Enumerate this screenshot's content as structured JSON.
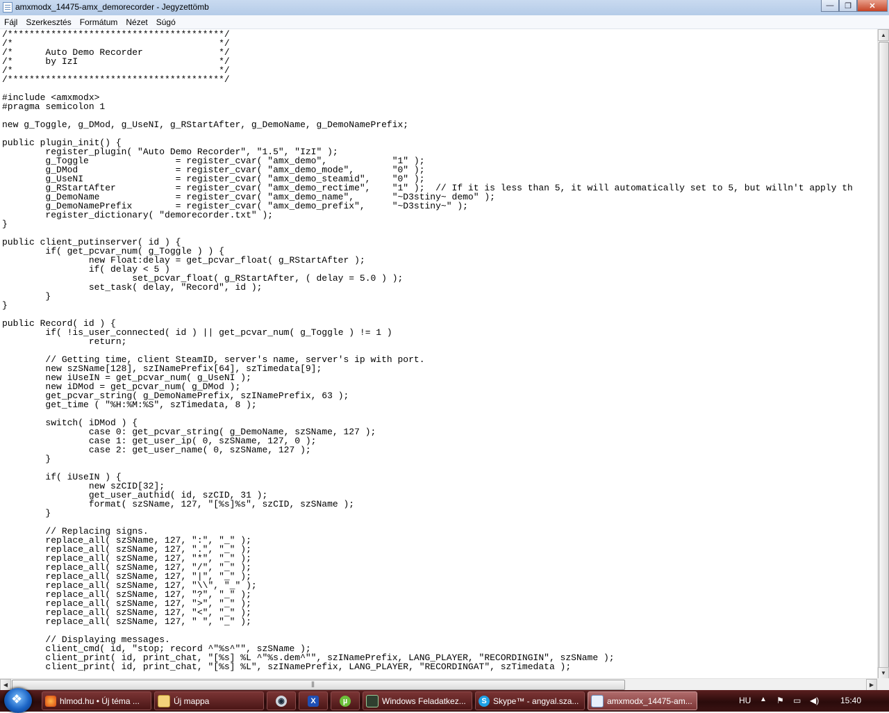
{
  "window": {
    "title": "amxmodx_14475-amx_demorecorder - Jegyzettömb",
    "buttons": {
      "minimize": "—",
      "maximize": "❐",
      "close": "✕"
    }
  },
  "menu": [
    "Fájl",
    "Szerkesztés",
    "Formátum",
    "Nézet",
    "Súgó"
  ],
  "editor": {
    "lines": [
      "/****************************************/",
      "/*\t\t\t\t\t*/",
      "/*\tAuto Demo Recorder\t\t*/",
      "/*\tby IzI\t\t\t\t*/",
      "/*\t\t\t\t\t*/",
      "/****************************************/",
      "",
      "#include <amxmodx>",
      "#pragma semicolon 1",
      "",
      "new g_Toggle, g_DMod, g_UseNI, g_RStartAfter, g_DemoName, g_DemoNamePrefix;",
      "",
      "public plugin_init() {",
      "\tregister_plugin( \"Auto Demo Recorder\", \"1.5\", \"IzI\" );",
      "\tg_Toggle\t\t= register_cvar( \"amx_demo\",\t\t\"1\" );",
      "\tg_DMod\t\t\t= register_cvar( \"amx_demo_mode\",\t\"0\" );",
      "\tg_UseNI\t\t\t= register_cvar( \"amx_demo_steamid\",\t\"0\" );",
      "\tg_RStartAfter\t\t= register_cvar( \"amx_demo_rectime\",\t\"1\" );\t// If it is less than 5, it will automatically set to 5, but willn't apply th",
      "\tg_DemoName\t\t= register_cvar( \"amx_demo_name\",\t\"~D3stiny~ demo\" );",
      "\tg_DemoNamePrefix\t= register_cvar( \"amx_demo_prefix\",\t\"~D3stiny~\" );",
      "\tregister_dictionary( \"demorecorder.txt\" );",
      "}",
      "",
      "public client_putinserver( id ) {",
      "\tif( get_pcvar_num( g_Toggle ) ) {",
      "\t\tnew Float:delay = get_pcvar_float( g_RStartAfter );",
      "\t\tif( delay < 5 )",
      "\t\t\tset_pcvar_float( g_RStartAfter, ( delay = 5.0 ) );",
      "\t\tset_task( delay, \"Record\", id );",
      "\t}",
      "}",
      "",
      "public Record( id ) {",
      "\tif( !is_user_connected( id ) || get_pcvar_num( g_Toggle ) != 1 )",
      "\t\treturn;",
      "",
      "\t// Getting time, client SteamID, server's name, server's ip with port.",
      "\tnew szSName[128], szINamePrefix[64], szTimedata[9];",
      "\tnew iUseIN = get_pcvar_num( g_UseNI );",
      "\tnew iDMod = get_pcvar_num( g_DMod );",
      "\tget_pcvar_string( g_DemoNamePrefix, szINamePrefix, 63 );",
      "\tget_time ( \"%H:%M:%S\", szTimedata, 8 );",
      "",
      "\tswitch( iDMod ) {",
      "\t\tcase 0: get_pcvar_string( g_DemoName, szSName, 127 );",
      "\t\tcase 1: get_user_ip( 0, szSName, 127, 0 );",
      "\t\tcase 2: get_user_name( 0, szSName, 127 );",
      "\t}",
      "",
      "\tif( iUseIN ) {",
      "\t\tnew szCID[32];",
      "\t\tget_user_authid( id, szCID, 31 );",
      "\t\tformat( szSName, 127, \"[%s]%s\", szCID, szSName );",
      "\t}",
      "",
      "\t// Replacing signs.",
      "\treplace_all( szSName, 127, \":\", \"_\" );",
      "\treplace_all( szSName, 127, \".\", \"_\" );",
      "\treplace_all( szSName, 127, \"*\", \"_\" );",
      "\treplace_all( szSName, 127, \"/\", \"_\" );",
      "\treplace_all( szSName, 127, \"|\", \"_\" );",
      "\treplace_all( szSName, 127, \"\\\\\", \"_\" );",
      "\treplace_all( szSName, 127, \"?\", \"_\" );",
      "\treplace_all( szSName, 127, \">\", \"_\" );",
      "\treplace_all( szSName, 127, \"<\", \"_\" );",
      "\treplace_all( szSName, 127, \" \", \"_\" );",
      "",
      "\t// Displaying messages.",
      "\tclient_cmd( id, \"stop; record ^\"%s^\"\", szSName );",
      "\tclient_print( id, print_chat, \"[%s] %L ^\"%s.dem^\"\", szINamePrefix, LANG_PLAYER, \"RECORDINGIN\", szSName );",
      "\tclient_print( id, print_chat, \"[%s] %L\", szINamePrefix, LANG_PLAYER, \"RECORDINGAT\", szTimedata );"
    ]
  },
  "taskbar": {
    "items": [
      {
        "label": "hlmod.hu • Új téma ...",
        "icon": "firefox-icon"
      },
      {
        "label": "Új mappa",
        "icon": "folder-icon"
      },
      {
        "label": "",
        "icon": "steam-icon"
      },
      {
        "label": "",
        "icon": "app-x-icon"
      },
      {
        "label": "",
        "icon": "utorrent-icon"
      },
      {
        "label": "Windows Feladatkez...",
        "icon": "task-manager-icon"
      },
      {
        "label": "Skype™ - angyal.sza...",
        "icon": "skype-icon"
      },
      {
        "label": "amxmodx_14475-am...",
        "icon": "notepad-icon"
      }
    ],
    "tray": {
      "language": "HU",
      "clock": "15:40"
    }
  },
  "colors": {
    "taskbar": "#3a1212",
    "titlebar": "#c9daf0"
  }
}
